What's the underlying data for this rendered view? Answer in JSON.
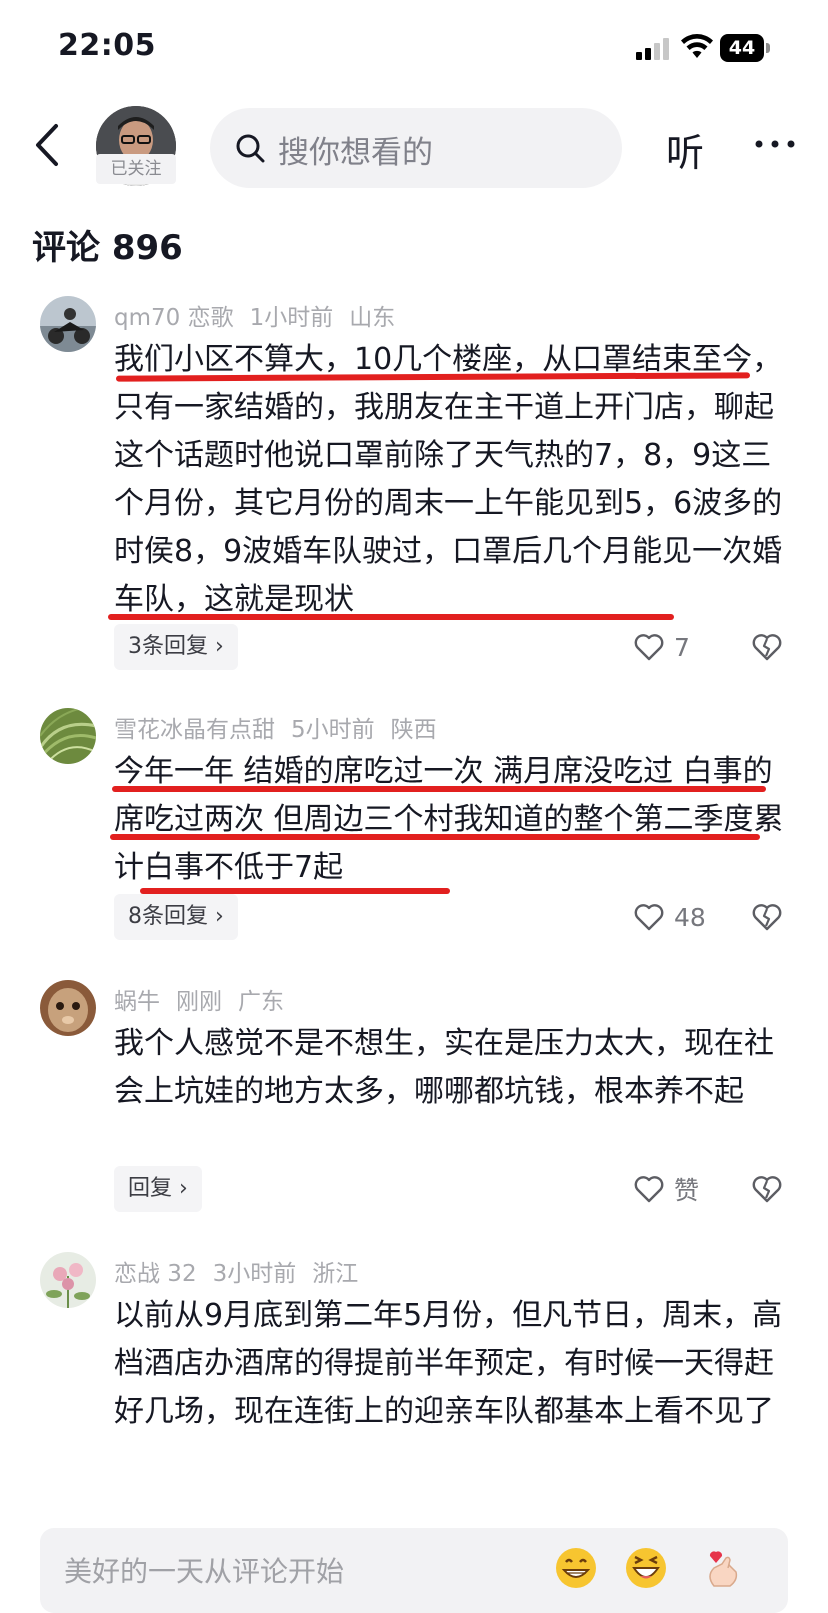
{
  "status_bar": {
    "time": "22:05",
    "battery": "44"
  },
  "header": {
    "followed_label": "已关注",
    "search_placeholder": "搜你想看的",
    "listen_label": "听"
  },
  "comments_title": "评论 896",
  "comments": [
    {
      "user": "qm70 恋歌",
      "time": "1小时前",
      "location": "山东",
      "text": "我们小区不算大，10几个楼座，从口罩结束至今，只有一家结婚的，我朋友在主干道上开门店，聊起这个话题时他说口罩前除了天气热的7，8，9这三个月份，其它月份的周末一上午能见到5，6波多的时侯8，9波婚车队驶过，口罩后几个月能见一次婚车队，这就是现状",
      "reply_label": "3条回复 ›",
      "likes": "7"
    },
    {
      "user": "雪花冰晶有点甜",
      "time": "5小时前",
      "location": "陕西",
      "text": "今年一年 结婚的席吃过一次 满月席没吃过 白事的席吃过两次 但周边三个村我知道的整个第二季度累计白事不低于7起",
      "reply_label": "8条回复 ›",
      "likes": "48"
    },
    {
      "user": "蜗牛",
      "time": "刚刚",
      "location": "广东",
      "text": "我个人感觉不是不想生，实在是压力太大，现在社会上坑娃的地方太多，哪哪都坑钱，根本养不起",
      "reply_label": "回复 ›",
      "likes": "赞"
    },
    {
      "user": "恋战 32",
      "time": "3小时前",
      "location": "浙江",
      "text": "以前从9月底到第二年5月份，但凡节日，周末，高档酒店办酒席的得提前半年预定，有时候一天得赶好几场，现在连街上的迎亲车队都基本上看不见了"
    }
  ],
  "bottom_input": {
    "placeholder": "美好的一天从评论开始"
  },
  "colors": {
    "underline": "#e2201f",
    "text": "#161823",
    "meta": "#a8a9ae"
  }
}
